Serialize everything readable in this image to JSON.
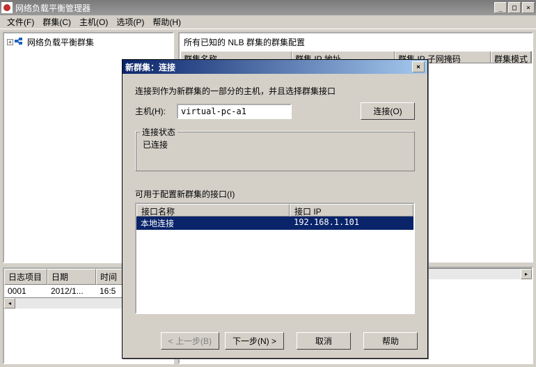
{
  "app": {
    "title": "网络负载平衡管理器",
    "icon_color": "#c03030"
  },
  "menu": {
    "file": "文件(F)",
    "cluster": "群集(C)",
    "host": "主机(O)",
    "options": "选项(P)",
    "help": "帮助(H)"
  },
  "tree": {
    "root": "网络负载平衡群集"
  },
  "config": {
    "title": "所有已知的 NLB 群集的群集配置",
    "columns": {
      "name": "群集名称",
      "ip": "群集 IP 地址",
      "subnet": "群集 IP 子网掩码",
      "mode": "群集模式"
    }
  },
  "log": {
    "columns": {
      "item": "日志项目",
      "date": "日期",
      "time": "时间"
    },
    "rows": [
      {
        "item": "0001",
        "date": "2012/1...",
        "time": "16:5"
      }
    ]
  },
  "dialog": {
    "title": "新群集：连接",
    "instructions": "连接到作为新群集的一部分的主机，并且选择群集接口",
    "host_label": "主机(H):",
    "host_value": "virtual-pc-a1",
    "connect_btn": "连接(O)",
    "status_legend": "连接状态",
    "status": "已连接",
    "interfaces_label": "可用于配置新群集的接口(I)",
    "iface_columns": {
      "name": "接口名称",
      "ip": "接口 IP"
    },
    "iface_rows": [
      {
        "name": "本地连接",
        "ip": "192.168.1.101"
      }
    ],
    "buttons": {
      "back": "< 上一步(B)",
      "next": "下一步(N) >",
      "cancel": "取消",
      "help": "帮助"
    }
  }
}
